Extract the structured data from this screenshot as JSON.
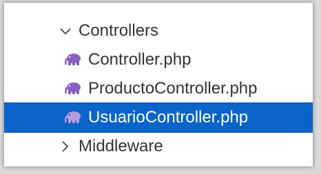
{
  "explorer": {
    "folder_open": {
      "label": "Controllers",
      "icon": "chevron-down-icon"
    },
    "files": [
      {
        "label": "Controller.php",
        "icon": "php-elephant-icon",
        "selected": false
      },
      {
        "label": "ProductoController.php",
        "icon": "php-elephant-icon",
        "selected": false
      },
      {
        "label": "UsuarioController.php",
        "icon": "php-elephant-icon",
        "selected": true
      }
    ],
    "folder_closed": {
      "label": "Middleware",
      "icon": "chevron-right-icon"
    }
  },
  "colors": {
    "selection": "#0a64c9",
    "php_icon": "#8a5fc4",
    "php_icon_selected": "#b89adf",
    "text": "#333333"
  }
}
